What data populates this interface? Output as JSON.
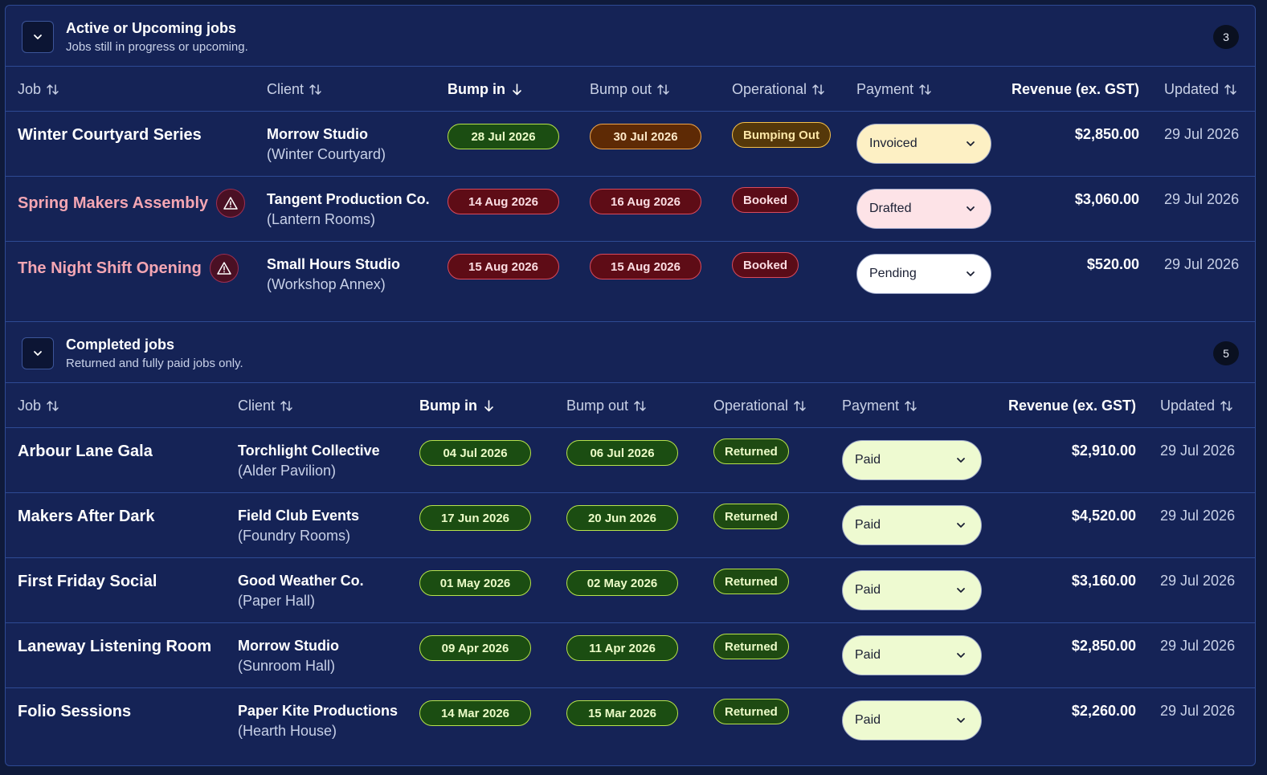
{
  "active": {
    "title": "Active or Upcoming jobs",
    "subtitle": "Jobs still in progress or upcoming.",
    "count": "3",
    "columns": {
      "job": "Job",
      "client": "Client",
      "bump_in": "Bump in",
      "bump_out": "Bump out",
      "operational": "Operational",
      "payment": "Payment",
      "revenue": "Revenue (ex. GST)",
      "updated": "Updated"
    },
    "rows": [
      {
        "job": "Winter Courtyard Series",
        "client": "Morrow Studio",
        "venue": "(Winter Courtyard)",
        "bump_in": "28 Jul 2026",
        "bump_out": "30 Jul 2026",
        "operational": "Bumping Out",
        "payment": "Invoiced",
        "revenue": "$2,850.00",
        "updated": "29 Jul 2026"
      },
      {
        "job": "Spring Makers Assembly",
        "client": "Tangent Production Co.",
        "venue": "(Lantern Rooms)",
        "bump_in": "14 Aug 2026",
        "bump_out": "16 Aug 2026",
        "operational": "Booked",
        "payment": "Drafted",
        "revenue": "$3,060.00",
        "updated": "29 Jul 2026"
      },
      {
        "job": "The Night Shift Opening",
        "client": "Small Hours Studio",
        "venue": "(Workshop Annex)",
        "bump_in": "15 Aug 2026",
        "bump_out": "15 Aug 2026",
        "operational": "Booked",
        "payment": "Pending",
        "revenue": "$520.00",
        "updated": "29 Jul 2026"
      }
    ]
  },
  "completed": {
    "title": "Completed jobs",
    "subtitle": "Returned and fully paid jobs only.",
    "count": "5",
    "columns": {
      "job": "Job",
      "client": "Client",
      "bump_in": "Bump in",
      "bump_out": "Bump out",
      "operational": "Operational",
      "payment": "Payment",
      "revenue": "Revenue (ex. GST)",
      "updated": "Updated"
    },
    "rows": [
      {
        "job": "Arbour Lane Gala",
        "client": "Torchlight Collective",
        "venue": "(Alder Pavilion)",
        "bump_in": "04 Jul 2026",
        "bump_out": "06 Jul 2026",
        "operational": "Returned",
        "payment": "Paid",
        "revenue": "$2,910.00",
        "updated": "29 Jul 2026"
      },
      {
        "job": "Makers After Dark",
        "client": "Field Club Events",
        "venue": "(Foundry Rooms)",
        "bump_in": "17 Jun 2026",
        "bump_out": "20 Jun 2026",
        "operational": "Returned",
        "payment": "Paid",
        "revenue": "$4,520.00",
        "updated": "29 Jul 2026"
      },
      {
        "job": "First Friday Social",
        "client": "Good Weather Co.",
        "venue": "(Paper Hall)",
        "bump_in": "01 May 2026",
        "bump_out": "02 May 2026",
        "operational": "Returned",
        "payment": "Paid",
        "revenue": "$3,160.00",
        "updated": "29 Jul 2026"
      },
      {
        "job": "Laneway Listening Room",
        "client": "Morrow Studio",
        "venue": "(Sunroom Hall)",
        "bump_in": "09 Apr 2026",
        "bump_out": "11 Apr 2026",
        "operational": "Returned",
        "payment": "Paid",
        "revenue": "$2,850.00",
        "updated": "29 Jul 2026"
      },
      {
        "job": "Folio Sessions",
        "client": "Paper Kite Productions",
        "venue": "(Hearth House)",
        "bump_in": "14 Mar 2026",
        "bump_out": "15 Mar 2026",
        "operational": "Returned",
        "payment": "Paid",
        "revenue": "$2,260.00",
        "updated": "29 Jul 2026"
      }
    ]
  },
  "icons": {
    "toggle": "chevron-down-icon",
    "sort": "sort-updown-icon",
    "sort_active": "arrow-down-icon",
    "warning": "warning-triangle-icon",
    "dropdown": "chevron-down-icon"
  },
  "colors": {
    "background": "#152356",
    "border": "#2e4a93",
    "warning_text": "#f4a6b3",
    "pill_green": "#b7e34a",
    "pill_red": "#d94a5c",
    "pill_amber": "#f1a64a"
  }
}
